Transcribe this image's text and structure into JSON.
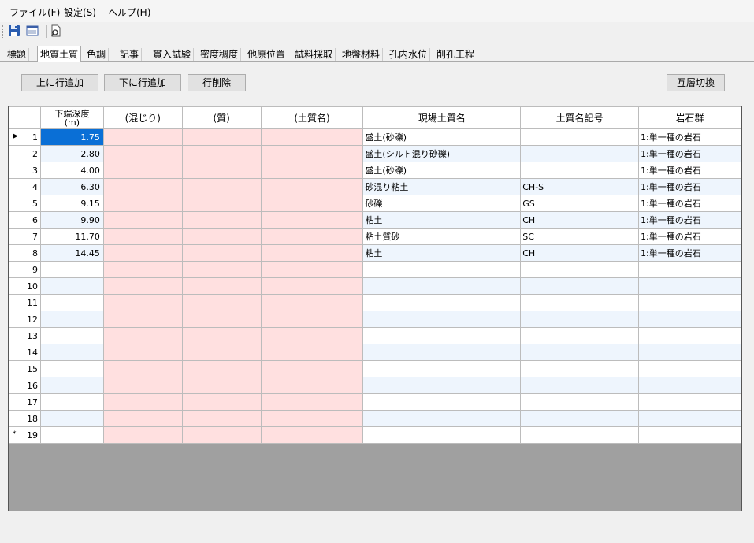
{
  "menu": {
    "file": "ファイル(F)",
    "settings": "設定(S)",
    "help": "ヘルプ(H)"
  },
  "toolbar": {
    "icons": [
      "save-icon",
      "form-icon",
      "preview-icon"
    ]
  },
  "tabs": [
    "標題",
    "地質土質",
    "色調",
    "記事",
    "貫入試験",
    "密度稠度",
    "他原位置",
    "試料採取",
    "地盤材料",
    "孔内水位",
    "削孔工程"
  ],
  "active_tab": "地質土質",
  "buttons": {
    "insert_above": "上に行追加",
    "insert_below": "下に行追加",
    "delete_row": "行削除",
    "switch_layer": "互層切換"
  },
  "grid": {
    "columns": {
      "depth_line1": "下端深度",
      "depth_line2": "(m)",
      "mixed": "(混じり)",
      "quality": "(質)",
      "soil_name": "(土質名)",
      "site_soil_name": "現場土質名",
      "soil_symbol": "土質名記号",
      "rock_group": "岩石群"
    },
    "current_row_marker": "▶",
    "new_row_marker": "*",
    "rows": [
      {
        "no": "1",
        "depth": "1.75",
        "site_name": "盛土(砂礫)",
        "symbol": "",
        "rock": "1:単一種の岩石"
      },
      {
        "no": "2",
        "depth": "2.80",
        "site_name": "盛土(シルト混り砂礫)",
        "symbol": "",
        "rock": "1:単一種の岩石"
      },
      {
        "no": "3",
        "depth": "4.00",
        "site_name": "盛土(砂礫)",
        "symbol": "",
        "rock": "1:単一種の岩石"
      },
      {
        "no": "4",
        "depth": "6.30",
        "site_name": "砂混り粘土",
        "symbol": "CH-S",
        "rock": "1:単一種の岩石"
      },
      {
        "no": "5",
        "depth": "9.15",
        "site_name": "砂礫",
        "symbol": "GS",
        "rock": "1:単一種の岩石"
      },
      {
        "no": "6",
        "depth": "9.90",
        "site_name": "粘土",
        "symbol": "CH",
        "rock": "1:単一種の岩石"
      },
      {
        "no": "7",
        "depth": "11.70",
        "site_name": "粘土質砂",
        "symbol": "SC",
        "rock": "1:単一種の岩石"
      },
      {
        "no": "8",
        "depth": "14.45",
        "site_name": "粘土",
        "symbol": "CH",
        "rock": "1:単一種の岩石"
      },
      {
        "no": "9",
        "depth": "",
        "site_name": "",
        "symbol": "",
        "rock": ""
      },
      {
        "no": "10",
        "depth": "",
        "site_name": "",
        "symbol": "",
        "rock": ""
      },
      {
        "no": "11",
        "depth": "",
        "site_name": "",
        "symbol": "",
        "rock": ""
      },
      {
        "no": "12",
        "depth": "",
        "site_name": "",
        "symbol": "",
        "rock": ""
      },
      {
        "no": "13",
        "depth": "",
        "site_name": "",
        "symbol": "",
        "rock": ""
      },
      {
        "no": "14",
        "depth": "",
        "site_name": "",
        "symbol": "",
        "rock": ""
      },
      {
        "no": "15",
        "depth": "",
        "site_name": "",
        "symbol": "",
        "rock": ""
      },
      {
        "no": "16",
        "depth": "",
        "site_name": "",
        "symbol": "",
        "rock": ""
      },
      {
        "no": "17",
        "depth": "",
        "site_name": "",
        "symbol": "",
        "rock": ""
      },
      {
        "no": "18",
        "depth": "",
        "site_name": "",
        "symbol": "",
        "rock": ""
      },
      {
        "no": "19",
        "depth": "",
        "site_name": "",
        "symbol": "",
        "rock": ""
      }
    ]
  },
  "colors": {
    "pink_cell": "#ffe0e0",
    "alt_row": "#eef5fd",
    "selected_cell": "#0a6fd6",
    "grid_background": "#a0a0a0"
  }
}
